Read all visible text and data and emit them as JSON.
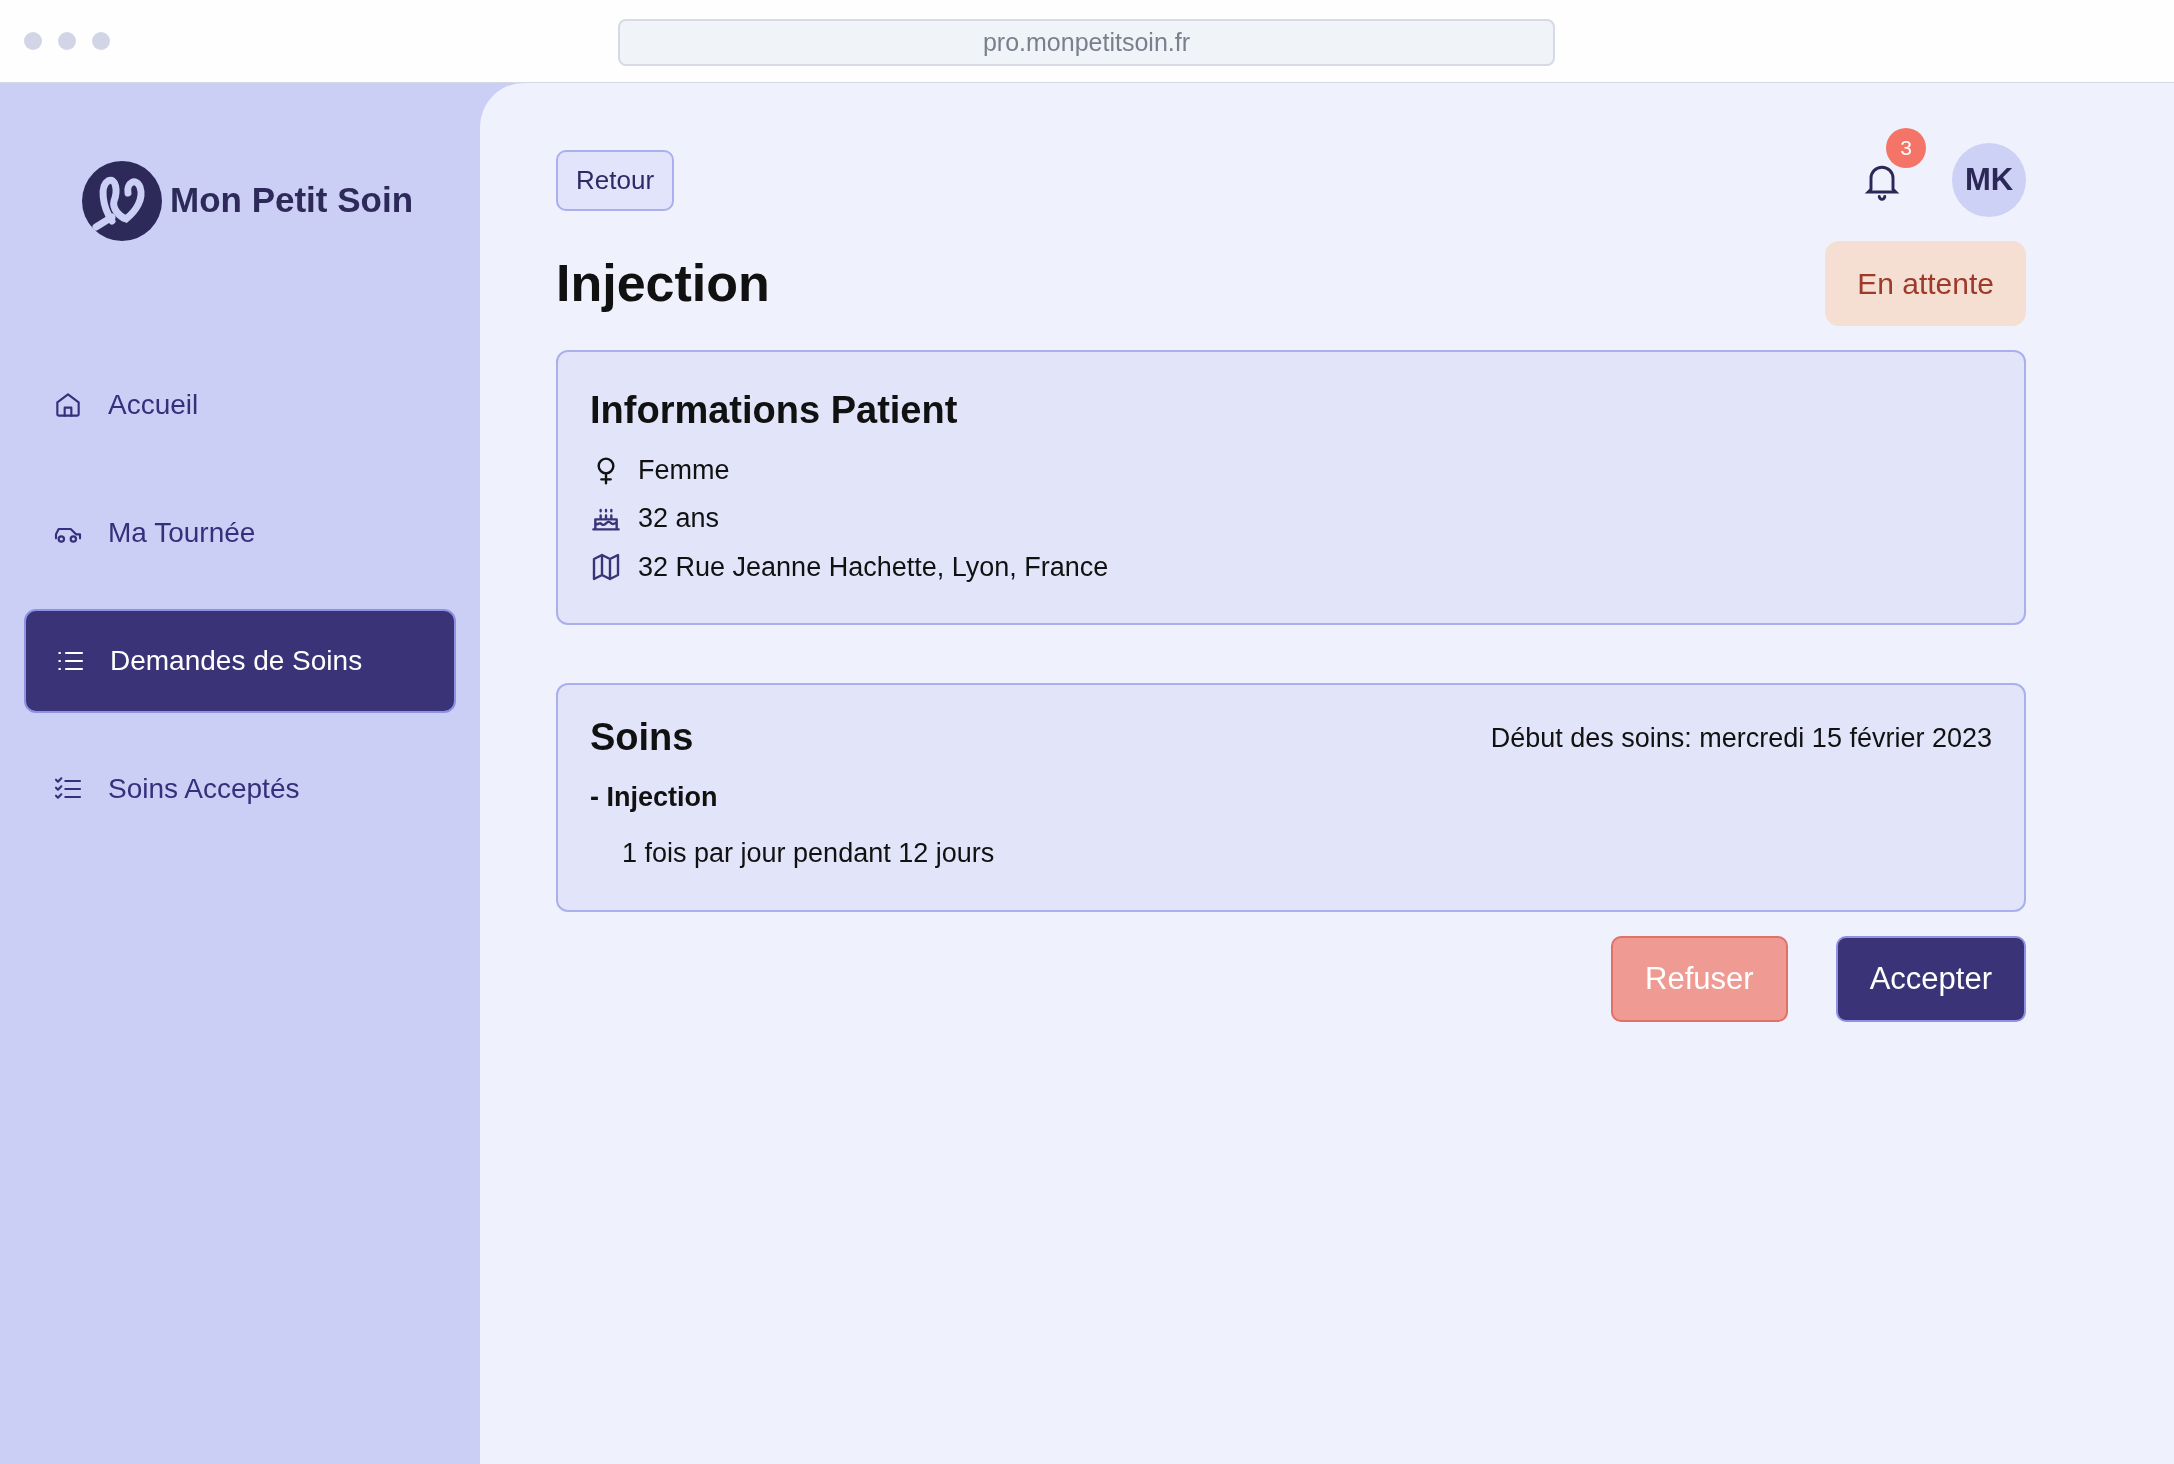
{
  "browser": {
    "url": "pro.monpetitsoin.fr"
  },
  "sidebar": {
    "brand": "Mon Petit Soin",
    "items": [
      {
        "label": "Accueil",
        "selected": false
      },
      {
        "label": "Ma Tournée",
        "selected": false
      },
      {
        "label": "Demandes de Soins",
        "selected": true
      },
      {
        "label": "Soins Acceptés",
        "selected": false
      }
    ]
  },
  "header": {
    "back_button": "Retour",
    "notification_count": "3",
    "avatar_initials": "MK"
  },
  "title": "Injection",
  "status": "En attente",
  "patient": {
    "title": "Informations Patient",
    "rows": [
      "Femme",
      "32 ans",
      "32 Rue Jeanne Hachette, Lyon, France"
    ]
  },
  "care": {
    "title": "Soins",
    "start": "Début des soins: mercredi 15 février 2023",
    "items": [
      {
        "name": "- Injection",
        "frequency": "1 fois par jour pendant 12 jours"
      }
    ]
  },
  "actions": [
    {
      "label": "Refuser",
      "kind": "danger"
    },
    {
      "label": "Accepter",
      "kind": "primary"
    }
  ]
}
